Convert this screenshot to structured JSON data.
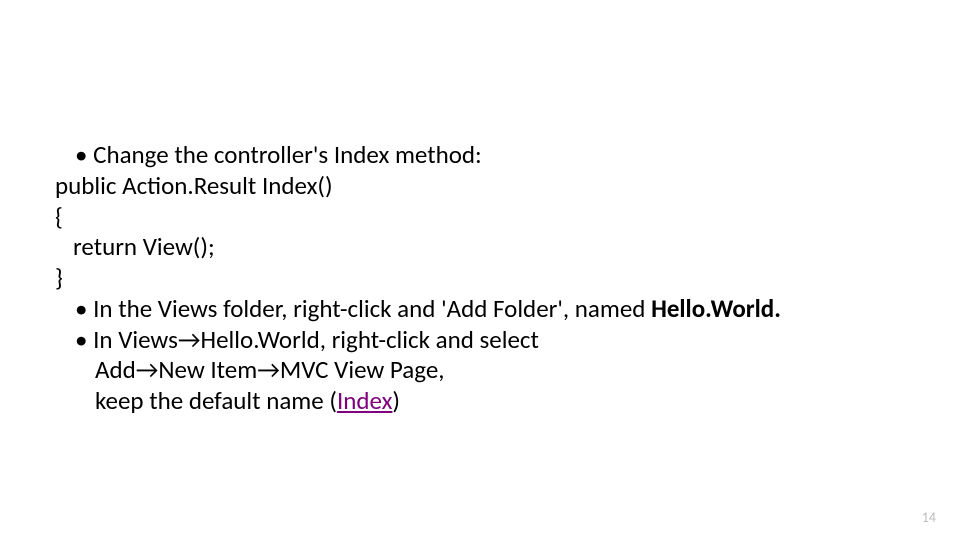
{
  "lines": {
    "l1_prefix": "• ",
    "l1_text": "Change the controller's Index method:",
    "l2": "public Action.Result Index()",
    "l3": "{",
    "l4": "return View();",
    "l5": "}",
    "l6_prefix": "• ",
    "l6_a": "In the Views folder, right-click and 'Add Folder', named ",
    "l6_b": "Hello.World.",
    "l7_prefix": "• ",
    "l7_a": "In Views",
    "l7_b": "Hello.World, right-click and select",
    "l8_a": "Add",
    "l8_b": "New Item",
    "l8_c": "MVC View Page,",
    "l9_a": "keep the default name (",
    "l9_link": "Index",
    "l9_b": ")"
  },
  "arrow": "→",
  "page_number": "14"
}
